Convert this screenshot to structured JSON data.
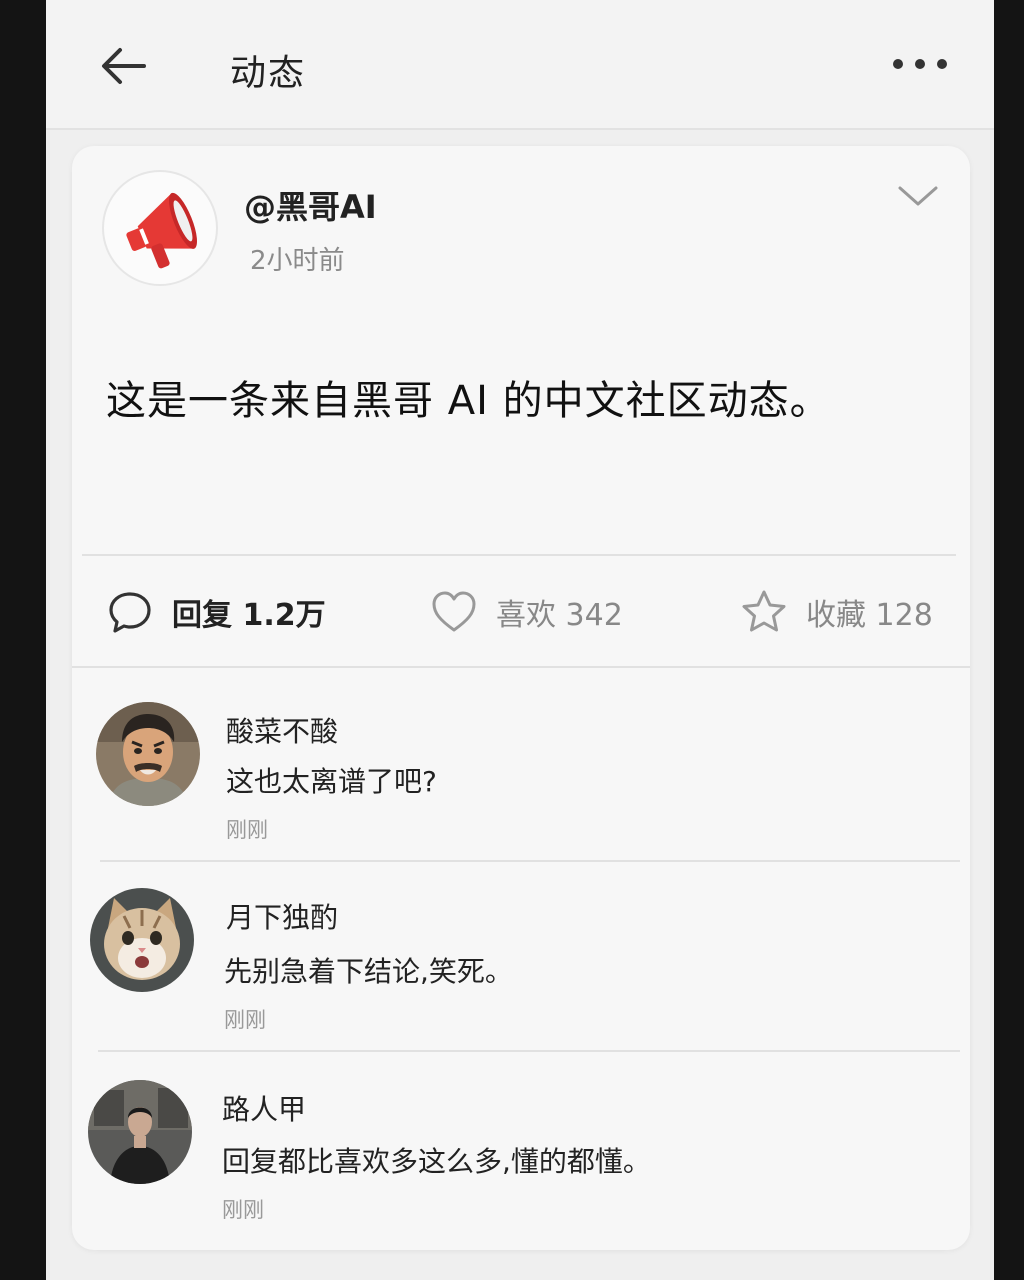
{
  "header": {
    "title": "动态",
    "back_icon": "back-arrow-icon",
    "more_icon": "more-dots-icon"
  },
  "post": {
    "author_name": "@黑哥AI",
    "time": "2小时前",
    "avatar_icon": "megaphone-icon",
    "menu_icon": "chevron-down-icon",
    "content": "这是一条来自黑哥 AI 的中文社区动态。",
    "actions": {
      "reply_label": "回复 1.2万",
      "like_label": "喜欢 342",
      "favorite_label": "收藏 128"
    }
  },
  "comments": [
    {
      "name": "酸菜不酸",
      "text": "这也太离谱了吧?",
      "time": "刚刚",
      "avatar": "angry-man-avatar"
    },
    {
      "name": "月下独酌",
      "text": "先别急着下结论,笑死。",
      "time": "刚刚",
      "avatar": "cat-avatar"
    },
    {
      "name": "路人甲",
      "text": "回复都比喜欢多这么多,懂的都懂。",
      "time": "刚刚",
      "avatar": "person-avatar"
    }
  ],
  "colors": {
    "accent_red": "#e53935",
    "text_primary": "#222222",
    "text_muted": "#8a8a8a"
  }
}
